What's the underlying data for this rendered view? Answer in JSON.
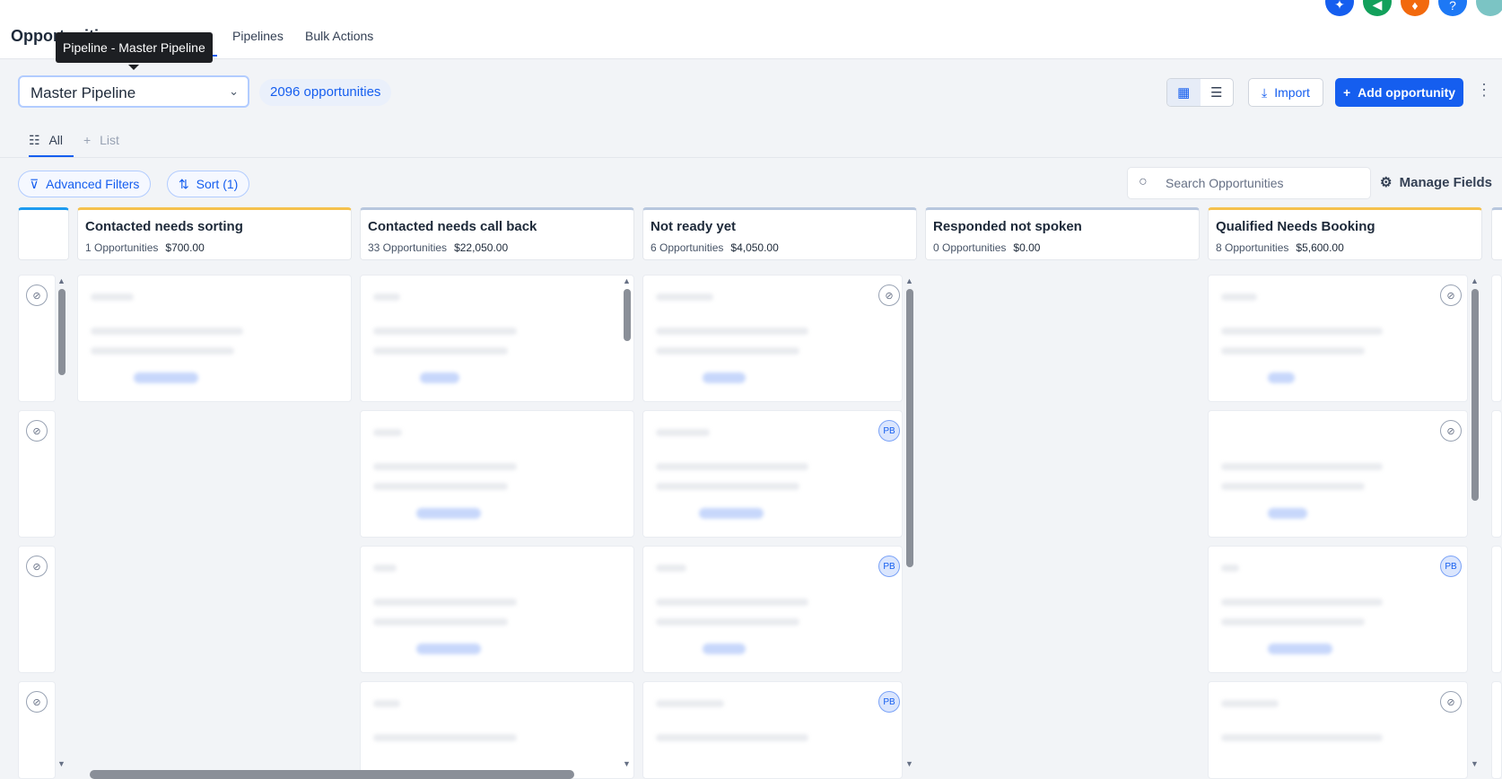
{
  "header": {
    "title": "Opportunities",
    "tabs": [
      "Pipelines",
      "Bulk Actions"
    ]
  },
  "tooltip": "Pipeline - Master Pipeline",
  "toolbar": {
    "pipeline_select": "Master Pipeline",
    "opportunity_count": "2096 opportunities",
    "import_label": "Import",
    "add_label": "Add opportunity"
  },
  "subtabs": {
    "all": "All",
    "list": "List"
  },
  "filters": {
    "advanced": "Advanced Filters",
    "sort": "Sort (1)",
    "search_placeholder": "Search Opportunities",
    "manage_fields": "Manage Fields"
  },
  "columns": [
    {
      "name": "Contacted needs sorting",
      "count": "1 Opportunities",
      "value": "$700.00"
    },
    {
      "name": "Contacted needs call back",
      "count": "33 Opportunities",
      "value": "$22,050.00"
    },
    {
      "name": "Not ready yet",
      "count": "6 Opportunities",
      "value": "$4,050.00"
    },
    {
      "name": "Responded not spoken",
      "count": "0 Opportunities",
      "value": "$0.00"
    },
    {
      "name": "Qualified Needs Booking",
      "count": "8 Opportunities",
      "value": "$5,600.00"
    }
  ],
  "avatar_initials": "PB",
  "colors": {
    "accent": "#155eef",
    "column_top": "#f5c14d"
  }
}
